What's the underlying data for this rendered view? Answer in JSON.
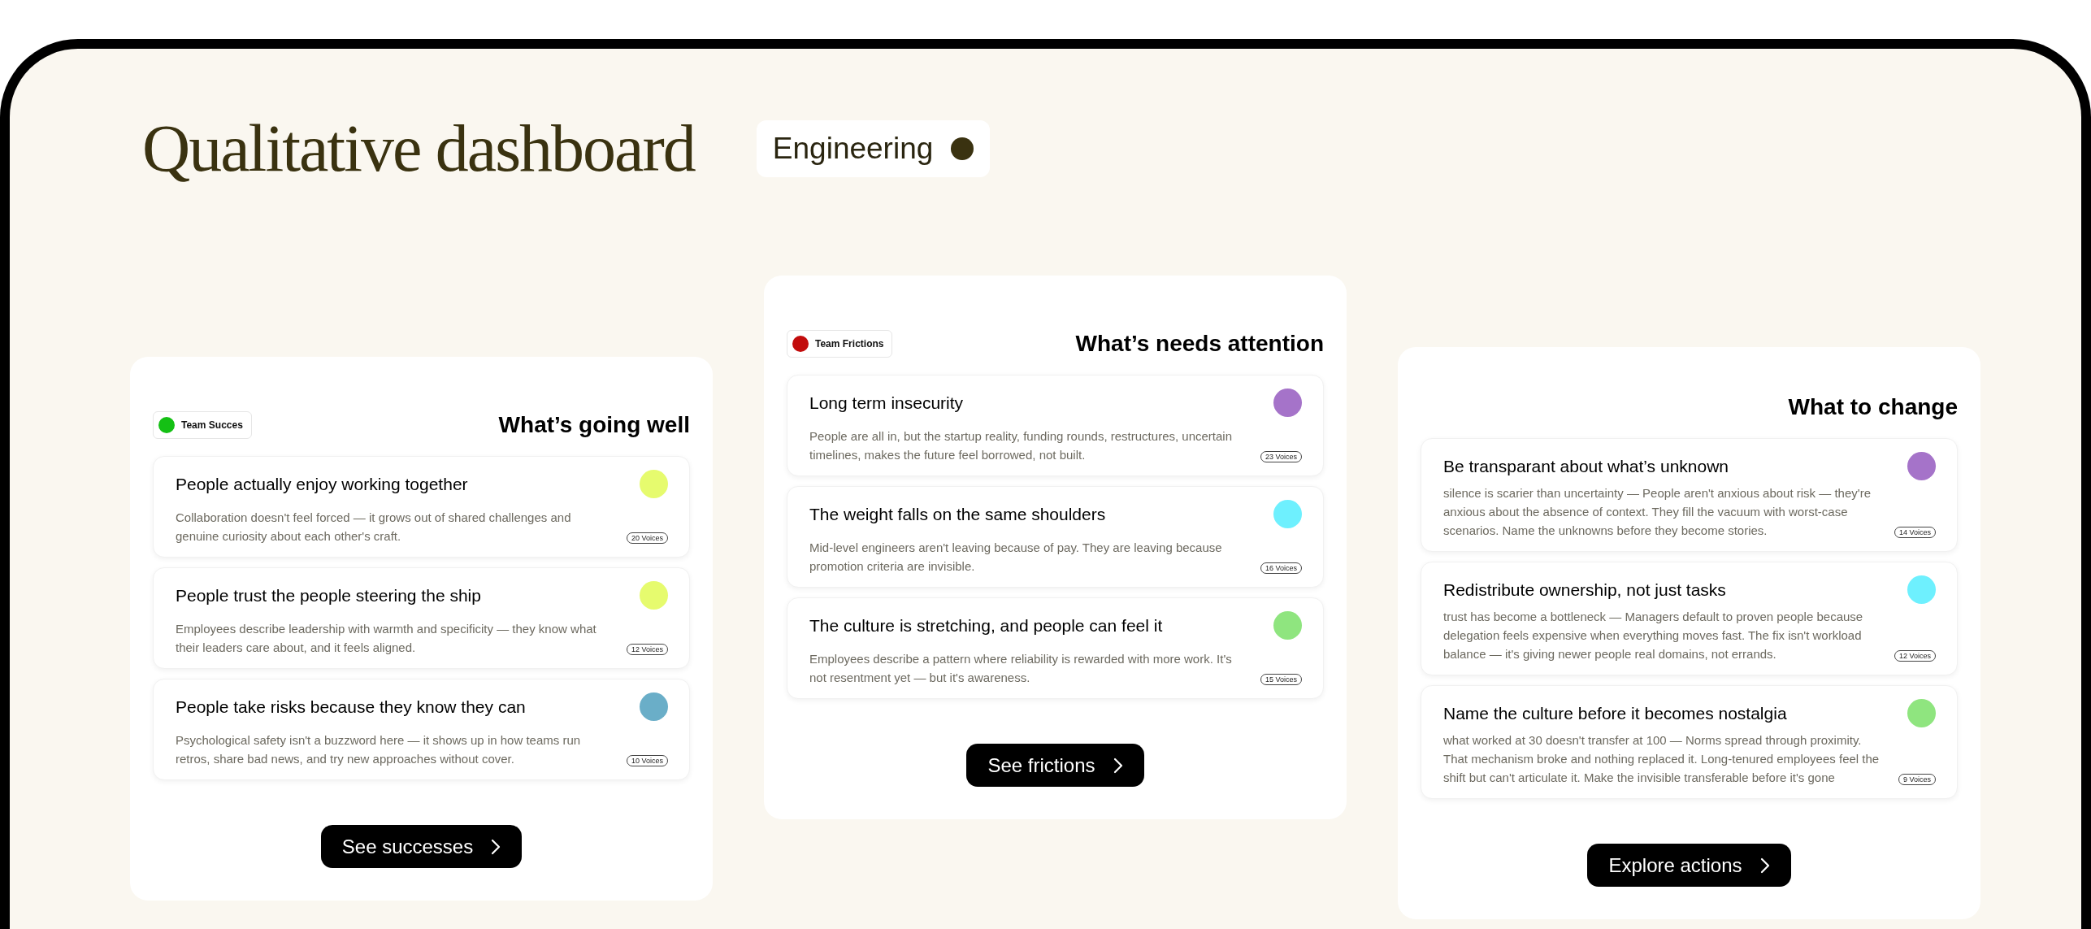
{
  "title": "Qualitative dashboard",
  "team_filter": {
    "label": "Engineering"
  },
  "panels": [
    {
      "badge": {
        "label": "Team Succes",
        "color": "#14c014"
      },
      "heading": "What’s going well",
      "items": [
        {
          "title": "People actually enjoy working together",
          "description": "Collaboration doesn't feel forced — it grows out of shared challenges and genuine curiosity about each other's craft.",
          "voices": "20 Voices",
          "color": "#e6fb6e"
        },
        {
          "title": "People trust the people steering the ship",
          "description": "Employees describe leadership with warmth and specificity — they know what their leaders care about, and it feels aligned.",
          "voices": "12 Voices",
          "color": "#e6fb6e"
        },
        {
          "title": "People take risks because they know they can",
          "description": "Psychological safety isn't a buzzword here — it shows up in how teams run retros, share bad news, and try new approaches without cover.",
          "voices": "10 Voices",
          "color": "#6aaec8"
        }
      ],
      "button": "See successes"
    },
    {
      "badge": {
        "label": "Team Frictions",
        "color": "#c20c0c"
      },
      "heading": "What’s needs attention",
      "items": [
        {
          "title": "Long term insecurity",
          "description": "People are all in, but the startup reality, funding rounds, restructures, uncertain timelines, makes the future feel borrowed, not built.",
          "voices": "23 Voices",
          "color": "#a573c9"
        },
        {
          "title": "The weight falls on the same shoulders",
          "description": "Mid-level engineers aren't leaving because of pay. They are leaving because promotion criteria are invisible.",
          "voices": "16 Voices",
          "color": "#6ef0fe"
        },
        {
          "title": "The culture is stretching, and people can feel it",
          "description": "Employees describe a pattern where reliability is rewarded with more work. It's not resentment yet — but it's awareness.",
          "voices": "15 Voices",
          "color": "#8fe57f"
        }
      ],
      "button": "See frictions"
    },
    {
      "heading": "What to change",
      "items": [
        {
          "title": "Be transparant about what’s unknown",
          "description": "silence is scarier than uncertainty — People aren't anxious about risk — they're anxious about the absence of context. They fill the vacuum with worst-case scenarios. Name the unknowns before they become stories.",
          "voices": "14 Voices",
          "color": "#a573c9"
        },
        {
          "title": "Redistribute ownership, not just tasks",
          "description": "trust has become a bottleneck — Managers default to proven people because delegation feels expensive when everything moves fast. The fix isn't workload balance — it's giving newer people real domains, not errands.",
          "voices": "12 Voices",
          "color": "#6ef0fe"
        },
        {
          "title": "Name the culture before it becomes nostalgia",
          "description": "what worked at 30 doesn't transfer at 100 — Norms spread through proximity. That mechanism broke and nothing replaced it. Long-tenured employees feel the shift but can't articulate it. Make the invisible transferable before it's gone",
          "voices": "9 Voices",
          "color": "#8fe57f"
        }
      ],
      "button": "Explore actions"
    }
  ]
}
